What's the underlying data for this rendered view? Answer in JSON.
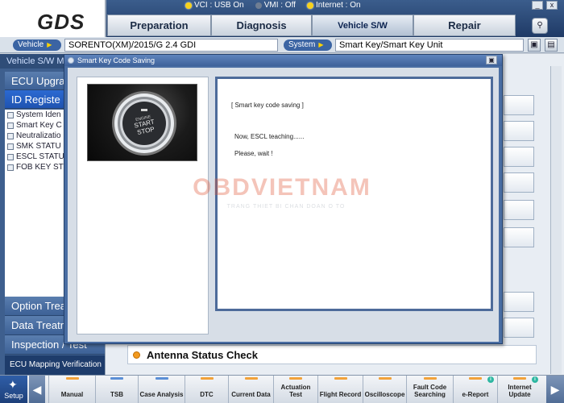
{
  "app": {
    "logo": "GDS",
    "status": {
      "vci": {
        "label": "VCI : USB On",
        "on": true
      },
      "vmi": {
        "label": "VMI : Off",
        "on": false
      },
      "internet": {
        "label": "Internet : On",
        "on": true
      }
    },
    "main_tabs": [
      {
        "label": "Preparation",
        "active": false
      },
      {
        "label": "Diagnosis",
        "active": false
      },
      {
        "label": "Vehicle S/W Management",
        "active": true
      },
      {
        "label": "Repair",
        "active": false
      }
    ],
    "window_controls": {
      "minimize": "_",
      "close": "x"
    }
  },
  "infobar": {
    "vehicle_label": "Vehicle",
    "vehicle_value": "SORENTO(XM)/2015/G 2.4 GDI",
    "system_label": "System",
    "system_value": "Smart Key/Smart Key Unit"
  },
  "left_panel": {
    "header": "Vehicle S/W M",
    "items_top": [
      {
        "label": "ECU Upgra",
        "selected": false
      },
      {
        "label": "ID Registe",
        "selected": true
      }
    ],
    "sub_items": [
      "System Iden",
      "Smart Key C",
      "Neutralizatio",
      "SMK STATU",
      "ESCL STATU",
      "FOB KEY ST"
    ],
    "items_bottom": [
      "Option Treatm",
      "Data Treatm",
      "Inspection / Test"
    ],
    "ecu_mapping": "ECU Mapping Verification"
  },
  "content": {
    "antenna_label": "Antenna Status Check"
  },
  "dialog": {
    "title": "Smart Key Code Saving",
    "image_text": [
      "ENGINE",
      "START",
      "STOP"
    ],
    "lines": [
      "[ Smart key code saving ]",
      "Now, ESCL teaching......",
      "Please, wait !"
    ]
  },
  "watermark": {
    "brand": "OBDVIETNAM",
    "tagline": "TRANG THIET BI CHAN DOAN O TO"
  },
  "toolbar": {
    "setup_label": "Setup",
    "items": [
      {
        "label": "Manual",
        "color": "#f2a23a"
      },
      {
        "label": "TSB",
        "color": "#5b8fd6"
      },
      {
        "label": "Case Analysis",
        "color": "#5b8fd6"
      },
      {
        "label": "DTC",
        "color": "#f2a23a"
      },
      {
        "label": "Current Data",
        "color": "#f2a23a"
      },
      {
        "label": "Actuation Test",
        "color": "#f2a23a"
      },
      {
        "label": "Flight Record",
        "color": "#f2a23a"
      },
      {
        "label": "Oscilloscope",
        "color": "#f2a23a"
      },
      {
        "label": "Fault Code Searching",
        "color": "#f2a23a"
      },
      {
        "label": "e-Report",
        "color": "#f2a23a",
        "badge": "i"
      },
      {
        "label": "Internet Update",
        "color": "#f2a23a",
        "badge": "i"
      }
    ]
  },
  "colors": {
    "accent": "#3e5f8e",
    "selected": "#1f54b1",
    "watermark_red": "#e05a3a"
  }
}
